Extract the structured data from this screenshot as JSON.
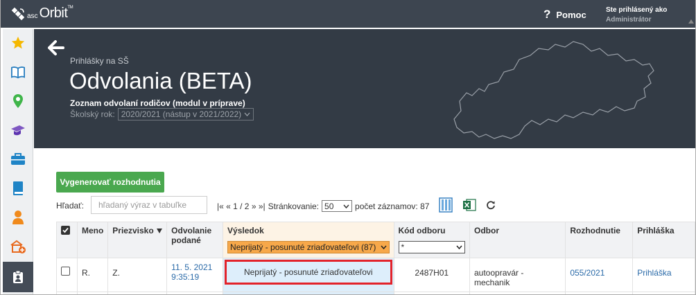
{
  "app": {
    "logo_asc": "asc",
    "logo_orbit": "Orbit",
    "logo_tm": "TM"
  },
  "topbar": {
    "help_icon": "?",
    "help_label": "Pomoc",
    "user_line1": "Ste prihlásený ako",
    "user_line2": "Administrátor"
  },
  "sidebar": {
    "items": [
      {
        "icon": "star-icon",
        "color": "#f5b800"
      },
      {
        "icon": "open-book-icon",
        "color": "#2a7fc0"
      },
      {
        "icon": "map-pin-icon",
        "color": "#3fb54a"
      },
      {
        "icon": "graduation-cap-icon",
        "color": "#7e57c2"
      },
      {
        "icon": "briefcase-icon",
        "color": "#1f84c6"
      },
      {
        "icon": "book-icon",
        "color": "#1f84c6"
      },
      {
        "icon": "person-icon",
        "color": "#f08a1c"
      },
      {
        "icon": "school-add-icon",
        "color": "#e86a1f"
      },
      {
        "icon": "clipboard-user-icon",
        "color": "#ffffff"
      }
    ]
  },
  "hero": {
    "breadcrumb": "Prihlášky na SŠ",
    "title": "Odvolania (BETA)",
    "subtitle": "Zoznam odvolaní rodičov (modul v príprave)",
    "year_label": "Školský rok:",
    "year_value": "2020/2021 (nástup v 2021/2022)"
  },
  "toolbar": {
    "generate_label": "Vygenerovať rozhodnutia",
    "search_label": "Hľadať:",
    "search_placeholder": "hľadaný výraz v tabuľke",
    "pager_nav": "|« « 1 / 2 » »|",
    "paging_label": "Stránkovanie:",
    "paging_value": "50",
    "records_label": "počet záznamov: 87"
  },
  "table": {
    "headers": {
      "meno": "Meno",
      "priezvisko": "Priezvisko",
      "odvolanie": "Odvolanie podané",
      "vysledok": "Výsledok",
      "kod": "Kód odboru",
      "odbor": "Odbor",
      "rozhodnutie": "Rozhodnutie",
      "prihlaska": "Prihláška"
    },
    "filters": {
      "vysledok": "Neprijatý - posunuté zriaďovateľovi (87)",
      "kod": "*"
    },
    "rows": [
      {
        "meno": "R.",
        "priezvisko": "Z.",
        "odvolanie_date": "11. 5. 2021",
        "odvolanie_time": "9:35:19",
        "vysledok": "Neprijatý - posunuté zriaďovateľovi",
        "kod": "2487H01",
        "odbor": "autoopravár - mechanik",
        "rozhodnutie": "055/2021",
        "prihlaska": "Prihláška"
      }
    ]
  },
  "colors": {
    "topbar": "#3d4550",
    "hero": "#333b45",
    "accent_green": "#4aa84f",
    "filter_orange": "#f7a84a",
    "highlight_red": "#e3232b",
    "link_blue": "#2a6aa8"
  }
}
